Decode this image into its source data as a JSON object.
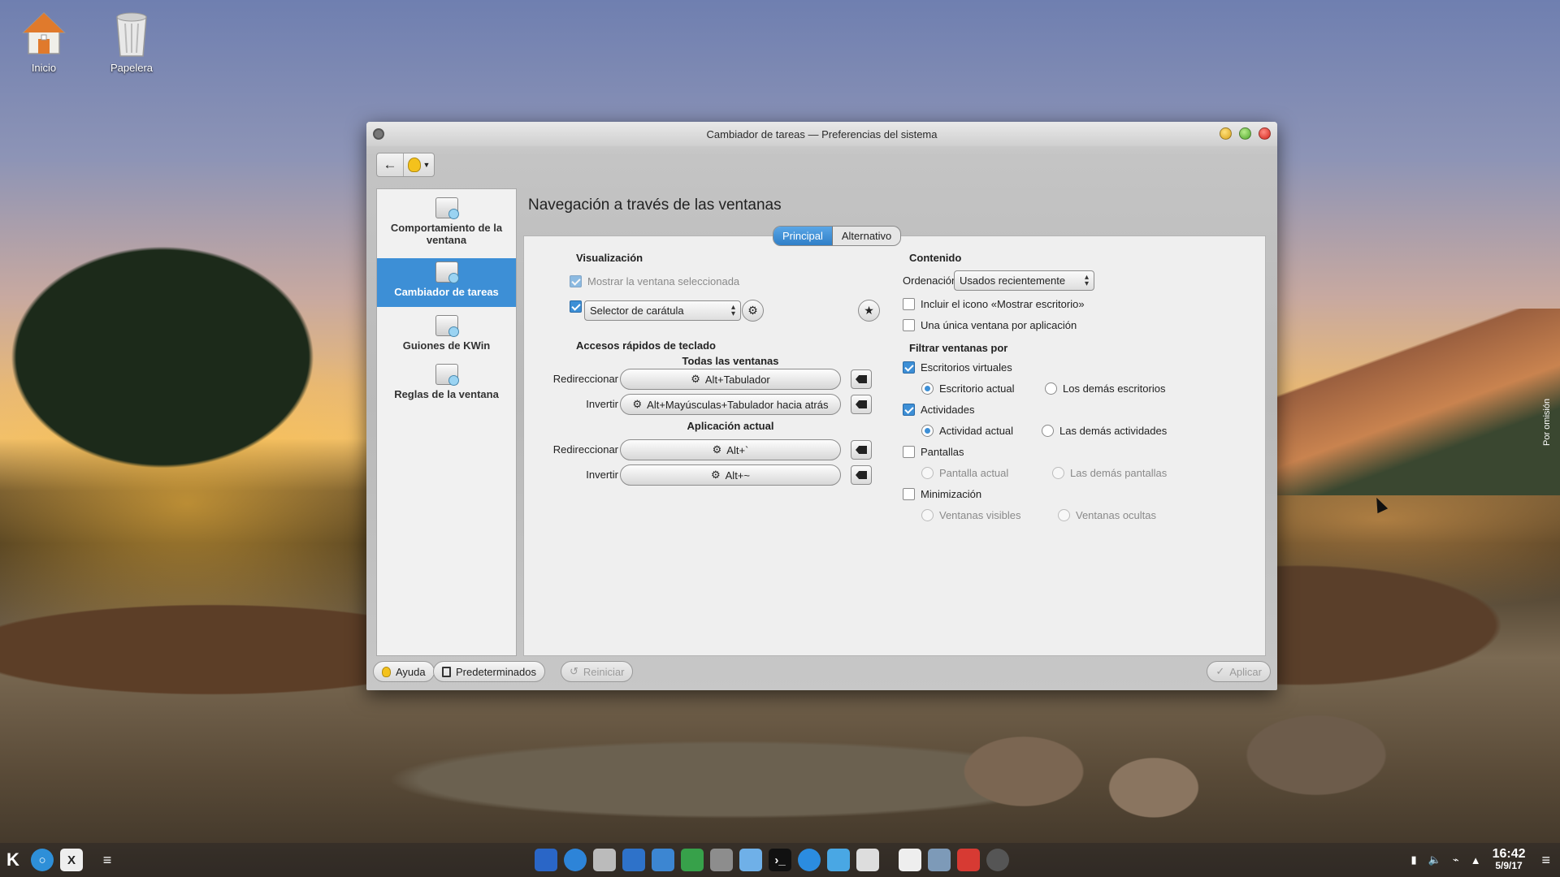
{
  "desktop": {
    "icons": [
      {
        "label": "Inicio",
        "icon": "home-folder-icon"
      },
      {
        "label": "Papelera",
        "icon": "trash-icon"
      }
    ],
    "side_tab_label": "Por omisión"
  },
  "window": {
    "title": "Cambiador de tareas — Preferencias del sistema",
    "toolbar": {
      "back_icon": "arrow-left-icon",
      "hint_icon": "lightbulb-icon"
    },
    "sidebar": [
      {
        "label": "Comportamiento de la ventana",
        "active": false
      },
      {
        "label": "Cambiador de tareas",
        "active": true
      },
      {
        "label": "Guiones de KWin",
        "active": false
      },
      {
        "label": "Reglas de la ventana",
        "active": false
      }
    ],
    "heading": "Navegación a través de las ventanas",
    "tabs": [
      "Principal",
      "Alternativo"
    ],
    "visualization": {
      "title": "Visualización",
      "show_selected": {
        "label": "Mostrar la ventana seleccionada",
        "checked": true,
        "enabled": false
      },
      "skin_checked": true,
      "skin_combo": "Selector de carátula"
    },
    "shortcuts": {
      "title": "Accesos rápidos de teclado",
      "all_windows": "Todas las ventanas",
      "current_app": "Aplicación actual",
      "labels": {
        "forward": "Redireccionar",
        "reverse": "Invertir"
      },
      "all_forward": "Alt+Tabulador",
      "all_reverse": "Alt+Mayúsculas+Tabulador hacia atrás",
      "app_forward": "Alt+`",
      "app_reverse": "Alt+~"
    },
    "content": {
      "title": "Contenido",
      "sort_label": "Ordenación:",
      "sort_value": "Usados recientemente",
      "include_desktop": "Incluir el icono «Mostrar escritorio»",
      "one_per_app": "Una única ventana por aplicación"
    },
    "filter": {
      "title": "Filtrar ventanas por",
      "virtual_desktops": "Escritorios virtuales",
      "current_desktop": "Escritorio actual",
      "other_desktops": "Los demás escritorios",
      "activities": "Actividades",
      "current_activity": "Actividad actual",
      "other_activities": "Las demás actividades",
      "screens": "Pantallas",
      "current_screen": "Pantalla actual",
      "other_screens": "Las demás pantallas",
      "minimization": "Minimización",
      "visible_windows": "Ventanas visibles",
      "hidden_windows": "Ventanas ocultas"
    },
    "buttons": {
      "help": "Ayuda",
      "defaults": "Predeterminados",
      "reset": "Reiniciar",
      "apply": "Aplicar"
    }
  },
  "taskbar": {
    "time": "16:42",
    "date": "5/9/17"
  },
  "colors": {
    "accent": "#3d8fd6"
  }
}
